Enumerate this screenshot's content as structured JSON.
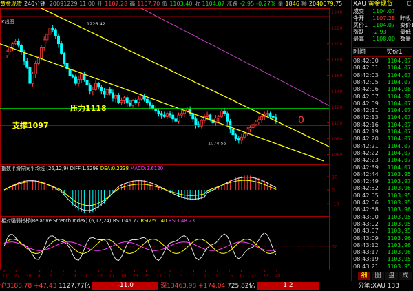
{
  "top_bar": {
    "symbol": "黄金现货",
    "period": "240分钟",
    "datetime": "20091229 11:00",
    "open_label": "开",
    "open": "1107.28",
    "high_label": "高",
    "high": "1107.70",
    "low_label": "低",
    "low": "1103.40",
    "close_label": "收",
    "close": "1104.07",
    "change_label": "涨跌",
    "change": "-2.95",
    "change_pct": "-0.27%",
    "volume_label": "量",
    "volume": "1846",
    "amount_label": "额",
    "amount": "2040679.75"
  },
  "main_pane": {
    "header": "K线图",
    "y_ticks": [
      "1240",
      "1220",
      "1200",
      "1180",
      "1160",
      "1140",
      "1120",
      "1100",
      "1080",
      "1060"
    ],
    "annotations": {
      "high_marker": "1226.42",
      "low_marker": "1074.55",
      "resistance_label": "压力1118",
      "support_label": "支撑1097",
      "signal_glyph": "0"
    },
    "colors": {
      "up": "#ff3c3c",
      "down": "#00ffff",
      "channel": "#ffff00",
      "trend": "#c040c0",
      "resistance": "#00e600",
      "support": "#ff0000"
    }
  },
  "macd_pane": {
    "title": "指数平滑异同平均线",
    "params": "(26,12,9)",
    "diff_label": "DIFF:",
    "diff": "1.5298",
    "dea_label": "DEA:",
    "dea": "0.2238",
    "macd_label": "MACD:",
    "macd": "2.6120",
    "y_ticks": [
      "10",
      "0",
      "-10"
    ]
  },
  "rsi_pane": {
    "title": "相对强弱指标(Relative Strenth Index)",
    "params": "(6,12,24)",
    "rsi1_label": "RSI1:",
    "rsi1": "46.77",
    "rsi2_label": "RSI2:",
    "rsi2": "51.40",
    "rsi3_label": "RSI3:",
    "rsi3": "48.23",
    "y_ticks": [
      "50"
    ]
  },
  "x_axis": [
    "11",
    "27",
    "30",
    "4",
    "6",
    "7",
    "9",
    "11",
    "13",
    "17",
    "19",
    "23",
    "25",
    "27",
    "1",
    "3",
    "7",
    "9",
    "11",
    "15",
    "17",
    "21",
    "23",
    "28"
  ],
  "right_panel": {
    "title_code": "XAU",
    "title_name": "黄金现货",
    "title_suffix": "C",
    "rows": [
      {
        "label": "成交",
        "value": "1104.07",
        "extra": ""
      },
      {
        "label": "今开",
        "value": "1107.28",
        "extra": "昨收"
      },
      {
        "label": "买价1",
        "value": "1104.07",
        "extra": "卖价1"
      },
      {
        "label": "涨跌",
        "value": "-2.93",
        "extra": "最低"
      },
      {
        "label": "最高",
        "value": "1108.00",
        "extra": "数量"
      }
    ],
    "tick_header_time": "时间",
    "tick_header_price": "买价1",
    "ticks": [
      {
        "time": "08:42:00",
        "price": "1104.07"
      },
      {
        "time": "08:42:01",
        "price": "1104.07"
      },
      {
        "time": "08:42:03",
        "price": "1104.07"
      },
      {
        "time": "08:42:05",
        "price": "1104.07"
      },
      {
        "time": "08:42:06",
        "price": "1104.08"
      },
      {
        "time": "08:42:07",
        "price": "1104.08"
      },
      {
        "time": "08:42:09",
        "price": "1104.07"
      },
      {
        "time": "08:42:11",
        "price": "1104.07"
      },
      {
        "time": "08:42:13",
        "price": "1104.07"
      },
      {
        "time": "08:42:16",
        "price": "1104.07"
      },
      {
        "time": "08:42:19",
        "price": "1104.07"
      },
      {
        "time": "08:42:20",
        "price": "1104.07"
      },
      {
        "time": "08:42:21",
        "price": "1104.07"
      },
      {
        "time": "08:42:22",
        "price": "1104.07"
      },
      {
        "time": "08:42:23",
        "price": "1104.07"
      },
      {
        "time": "08:42:39",
        "price": "1104.07"
      },
      {
        "time": "08:42:44",
        "price": "1103.95"
      },
      {
        "time": "08:42:49",
        "price": "1103.97"
      },
      {
        "time": "08:42:52",
        "price": "1103.96"
      },
      {
        "time": "08:42:55",
        "price": "1103.95"
      },
      {
        "time": "08:42:56",
        "price": "1103.95"
      },
      {
        "time": "08:42:58",
        "price": "1103.96"
      },
      {
        "time": "08:43:00",
        "price": "1103.95"
      },
      {
        "time": "08:43:02",
        "price": "1103.95"
      },
      {
        "time": "08:43:07",
        "price": "1103.95"
      },
      {
        "time": "08:43:09",
        "price": "1103.96"
      },
      {
        "time": "08:43:12",
        "price": "1103.96"
      },
      {
        "time": "08:43:17",
        "price": "1103.96"
      },
      {
        "time": "08:43:19",
        "price": "1103.95"
      },
      {
        "time": "08:43:21",
        "price": "1103.95"
      }
    ],
    "tabs": [
      "细",
      "图",
      "盘",
      "成"
    ]
  },
  "status_bar": {
    "sh_label": "沪",
    "sh_index": "3188.78",
    "sh_change": "+47.43",
    "sh_amount": "1127.77亿",
    "sh_box": "-11.0",
    "sz_label": "深",
    "sz_index": "13463.98",
    "sz_change": "+174.04",
    "sz_amount": "725.82亿",
    "sz_box": "1.2",
    "feed_label": "分笔:XAU 133"
  }
}
